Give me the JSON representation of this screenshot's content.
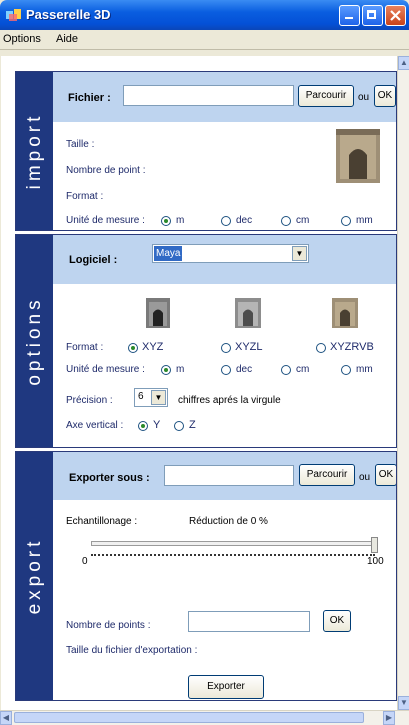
{
  "window": {
    "title": "Passerelle 3D"
  },
  "menu": [
    "Options",
    "Aide"
  ],
  "import": {
    "side_label": "import",
    "file_label": "Fichier :",
    "file_value": "",
    "browse_label": "Parcourir",
    "or_label": "ou",
    "ok_label": "OK",
    "size_label": "Taille :",
    "points_label": "Nombre de point :",
    "format_label": "Format :",
    "unit_label": "Unité de mesure :",
    "units": [
      "m",
      "dec",
      "cm",
      "mm"
    ],
    "unit_selected": "m"
  },
  "options": {
    "side_label": "options",
    "software_label": "Logiciel :",
    "software_value": "Maya",
    "format_label": "Format :",
    "formats": [
      "XYZ",
      "XYZL",
      "XYZRVB"
    ],
    "format_selected": "XYZ",
    "unit_label": "Unité de mesure :",
    "units": [
      "m",
      "dec",
      "cm",
      "mm"
    ],
    "unit_selected": "m",
    "precision_label": "Précision :",
    "precision_value": "6",
    "precision_suffix": "chiffres aprés la virgule",
    "axis_label": "Axe vertical :",
    "axes": [
      "Y",
      "Z"
    ],
    "axis_selected": "Y"
  },
  "export": {
    "side_label": "export",
    "export_label": "Exporter sous :",
    "export_value": "",
    "browse_label": "Parcourir",
    "or_label": "ou",
    "ok_label": "OK",
    "sampling_label": "Echantillonage :",
    "reduction_label": "Réduction de 0 %",
    "slider_min": "0",
    "slider_max": "100",
    "slider_value": 100,
    "points_label": "Nombre de points :",
    "points_value": "",
    "points_ok": "OK",
    "filesize_label": "Taille du fichier d'exportation :",
    "export_button": "Exporter"
  },
  "colors": {
    "side_panel": "#1f3880",
    "header": "#bed4ef",
    "titlebar": "#0a5ee0",
    "close": "#c9431a"
  }
}
